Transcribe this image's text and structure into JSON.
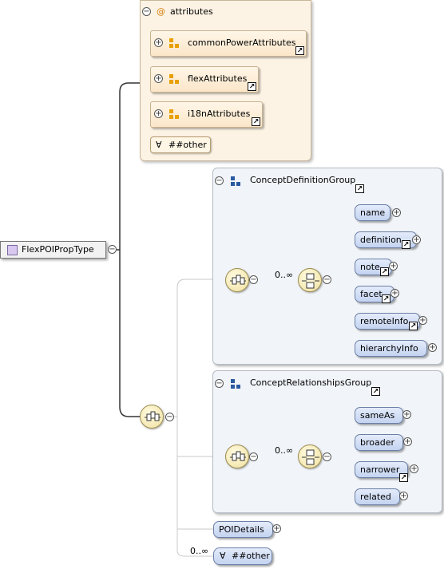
{
  "root": {
    "label": "FlexPOIPropType"
  },
  "attributes": {
    "title": "attributes",
    "items": [
      {
        "label": "commonPowerAttributes"
      },
      {
        "label": "flexAttributes"
      },
      {
        "label": "i18nAttributes"
      }
    ],
    "any_label": "##other"
  },
  "groups": [
    {
      "title": "ConceptDefinitionGroup",
      "multiplicity": "0..∞",
      "elements": [
        {
          "label": "name"
        },
        {
          "label": "definition"
        },
        {
          "label": "note"
        },
        {
          "label": "facet"
        },
        {
          "label": "remoteInfo"
        },
        {
          "label": "hierarchyInfo"
        }
      ]
    },
    {
      "title": "ConceptRelationshipsGroup",
      "multiplicity": "0..∞",
      "elements": [
        {
          "label": "sameAs"
        },
        {
          "label": "broader"
        },
        {
          "label": "narrower"
        },
        {
          "label": "related"
        }
      ]
    }
  ],
  "poi_details": {
    "label": "POIDetails"
  },
  "any_other": {
    "multiplicity": "0..∞",
    "label": "##other"
  },
  "colors": {
    "attribute_panel": "#fdf3e4",
    "group_panel": "#f1f4f8",
    "element_fill": "#c4d3f0",
    "compositor": "#f0e0a0"
  }
}
